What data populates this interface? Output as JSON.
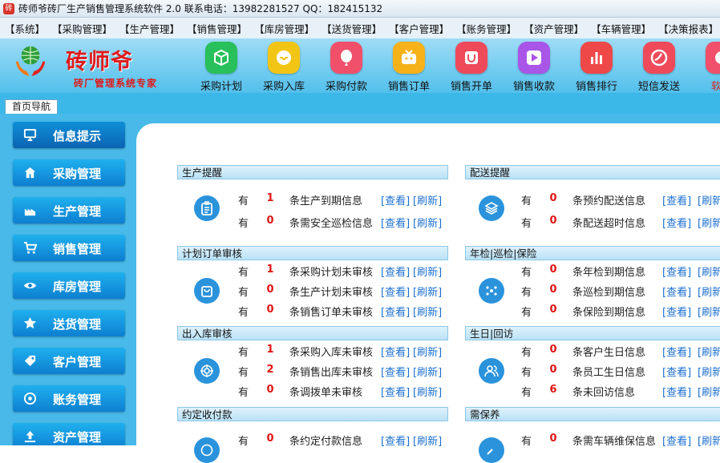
{
  "window": {
    "title": "砖师爷砖厂生产销售管理系统软件 2.0 联系电话：13982281527 QQ：182415132"
  },
  "menu": [
    "【系统】",
    "【采购管理】",
    "【生产管理】",
    "【销售管理】",
    "【库房管理】",
    "【送货管理】",
    "【客户管理】",
    "【账务管理】",
    "【资产管理】",
    "【车辆管理】",
    "【决策报表】"
  ],
  "logo": {
    "name": "砖师爷",
    "subtitle": "砖厂管理系统专家"
  },
  "toolbar": [
    {
      "label": "采购计划",
      "icon": "cube-icon",
      "color": "#27c05a"
    },
    {
      "label": "采购入库",
      "icon": "inbox-icon",
      "color": "#f2c515"
    },
    {
      "label": "采购付款",
      "icon": "balloon-icon",
      "color": "#f0506a"
    },
    {
      "label": "销售订单",
      "icon": "tv-icon",
      "color": "#f7b21a"
    },
    {
      "label": "销售开单",
      "icon": "cup-icon",
      "color": "#ef4a5a"
    },
    {
      "label": "销售收款",
      "icon": "play-icon",
      "color": "#a855e8"
    },
    {
      "label": "销售排行",
      "icon": "bar-chart-icon",
      "color": "#ef4848"
    },
    {
      "label": "短信发送",
      "icon": "message-icon",
      "color": "#ef4a5a"
    },
    {
      "label": "软件",
      "icon": "software-icon",
      "color": "#f0506a"
    }
  ],
  "tab": {
    "home": "首页导航"
  },
  "sidebar": [
    {
      "label": "信息提示",
      "icon": "monitor-icon"
    },
    {
      "label": "采购管理",
      "icon": "home-icon"
    },
    {
      "label": "生产管理",
      "icon": "factory-icon"
    },
    {
      "label": "销售管理",
      "icon": "cart-icon"
    },
    {
      "label": "库房管理",
      "icon": "eye-icon"
    },
    {
      "label": "送货管理",
      "icon": "star-icon"
    },
    {
      "label": "客户管理",
      "icon": "tag-icon"
    },
    {
      "label": "账务管理",
      "icon": "coin-icon"
    },
    {
      "label": "资产管理",
      "icon": "upload-icon"
    }
  ],
  "links": {
    "view": "[查看]",
    "refresh": "[刷新]"
  },
  "row_prefix": "有",
  "sections": [
    {
      "title": "生产提醒",
      "icon": "clipboard-icon",
      "rows": [
        {
          "count": "1",
          "text": "条生产到期信息"
        },
        {
          "count": "0",
          "text": "条需安全巡检信息"
        }
      ]
    },
    {
      "title": "配送提醒",
      "icon": "layers-icon",
      "rows": [
        {
          "count": "0",
          "text": "条预约配送信息"
        },
        {
          "count": "0",
          "text": "条配送超时信息"
        }
      ]
    },
    {
      "title": "计划订单审核",
      "icon": "bag-icon",
      "rows": [
        {
          "count": "1",
          "text": "条采购计划未审核"
        },
        {
          "count": "0",
          "text": "条生产计划未审核"
        },
        {
          "count": "0",
          "text": "条销售订单未审核"
        }
      ]
    },
    {
      "title": "年检|巡检|保险",
      "icon": "dots-icon",
      "rows": [
        {
          "count": "0",
          "text": "条年检到期信息"
        },
        {
          "count": "0",
          "text": "条巡检到期信息"
        },
        {
          "count": "0",
          "text": "条保险到期信息"
        }
      ]
    },
    {
      "title": "出入库审核",
      "icon": "target-icon",
      "rows": [
        {
          "count": "1",
          "text": "条采购入库未审核"
        },
        {
          "count": "2",
          "text": "条销售出库未审核"
        },
        {
          "count": "0",
          "text": "条调拨单未审核"
        }
      ]
    },
    {
      "title": "生日|回访",
      "icon": "users-icon",
      "rows": [
        {
          "count": "0",
          "text": "条客户生日信息"
        },
        {
          "count": "0",
          "text": "条员工生日信息"
        },
        {
          "count": "6",
          "text": "条未回访信息"
        }
      ]
    },
    {
      "title": "约定收付款",
      "icon": "money-icon",
      "rows": [
        {
          "count": "0",
          "text": "条约定付款信息"
        }
      ]
    },
    {
      "title": "需保养",
      "icon": "wrench-icon",
      "rows": [
        {
          "count": "0",
          "text": "条需车辆维保信息"
        }
      ]
    }
  ]
}
